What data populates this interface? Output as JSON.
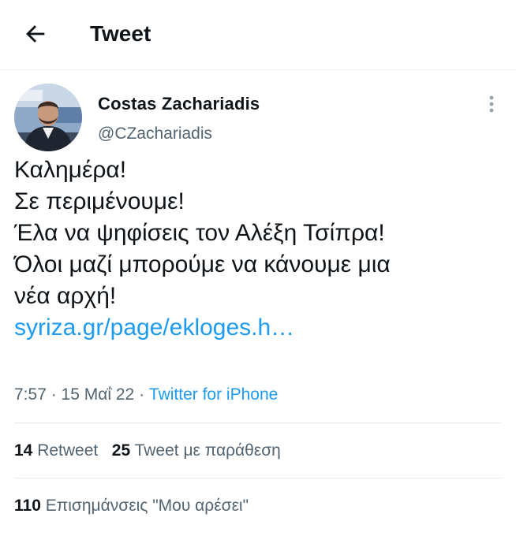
{
  "header": {
    "title": "Tweet",
    "back_icon": "arrow-left-icon"
  },
  "author": {
    "name": "Costas  Zachariadis",
    "handle": "@CZachariadis",
    "more_icon": "more-vertical-icon"
  },
  "tweet": {
    "lines": [
      "Καλημέρα!",
      "Σε περιμένουμε!",
      "Έλα να ψηφίσεις τον Αλέξη Τσίπρα!",
      "Όλοι μαζί μπορούμε να κάνουμε μια",
      "νέα αρχή!"
    ],
    "link": "syriza.gr/page/ekloges.h…"
  },
  "meta": {
    "time": "7:57",
    "dot1": " · ",
    "date": "15 Μαΐ 22",
    "dot2": " · ",
    "source": "Twitter for iPhone"
  },
  "stats": {
    "retweets_count": "14",
    "retweets_label": "Retweet",
    "quotes_count": "25",
    "quotes_label": "Tweet με παράθεση",
    "likes_count": "110",
    "likes_label": "Επισημάνσεις \"Μου αρέσει\""
  },
  "colors": {
    "link": "#1d9bf0",
    "secondary_text": "#536471",
    "primary_text": "#0f1419"
  }
}
